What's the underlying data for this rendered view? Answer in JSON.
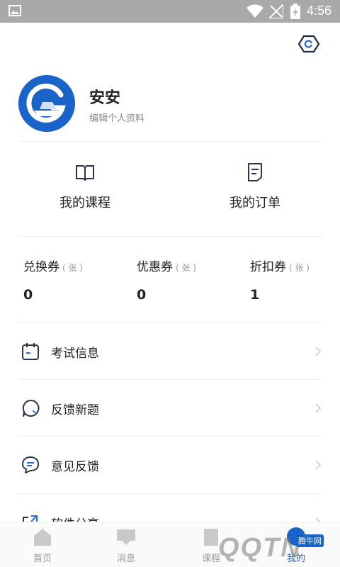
{
  "status_bar": {
    "time": "4:56",
    "icons": [
      "gallery-icon",
      "wifi-icon",
      "signal-icon",
      "battery-icon"
    ]
  },
  "header": {
    "settings_icon": "settings-icon"
  },
  "profile": {
    "name": "安安",
    "edit_label": "编辑个人资料",
    "avatar_color": "#1a63c9"
  },
  "quick_entries": [
    {
      "label": "我的课程",
      "icon": "book-icon"
    },
    {
      "label": "我的订单",
      "icon": "order-icon"
    }
  ],
  "coupons": [
    {
      "title": "兑换券",
      "unit": "( 张 )",
      "count": "0"
    },
    {
      "title": "优惠券",
      "unit": "( 张 )",
      "count": "0"
    },
    {
      "title": "折扣券",
      "unit": "( 张 )",
      "count": "1"
    }
  ],
  "menu": [
    {
      "label": "考试信息",
      "icon": "calendar-icon"
    },
    {
      "label": "反馈新题",
      "icon": "chat-bubble-icon"
    },
    {
      "label": "意见反馈",
      "icon": "message-icon"
    },
    {
      "label": "软件分享",
      "icon": "share-icon"
    }
  ],
  "bottom_nav": [
    {
      "label": "首页",
      "icon": "home-icon"
    },
    {
      "label": "消息",
      "icon": "inbox-icon"
    },
    {
      "label": "课程",
      "icon": "course-icon"
    },
    {
      "label": "我的",
      "icon": "profile-icon"
    }
  ],
  "watermark": {
    "text": "腾牛网",
    "logo": "QQTN"
  },
  "colors": {
    "status_bar": "#a9a9a9",
    "accent": "#1a63c9",
    "text": "#222222",
    "muted": "#999999",
    "divider": "#ececec"
  }
}
